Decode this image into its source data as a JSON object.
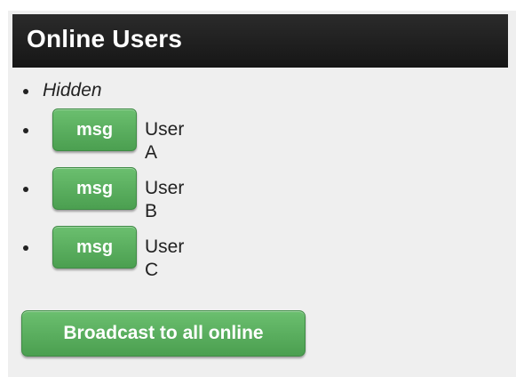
{
  "panel": {
    "title": "Online Users",
    "hidden_label": "Hidden",
    "users": [
      {
        "button_label": "msg",
        "name": "User A"
      },
      {
        "button_label": "msg",
        "name": "User B"
      },
      {
        "button_label": "msg",
        "name": "User C"
      }
    ],
    "broadcast_label": "Broadcast to all online"
  },
  "colors": {
    "header_bg": "#1e1e1e",
    "button_green": "#5aae5f",
    "panel_bg": "#efefef"
  }
}
